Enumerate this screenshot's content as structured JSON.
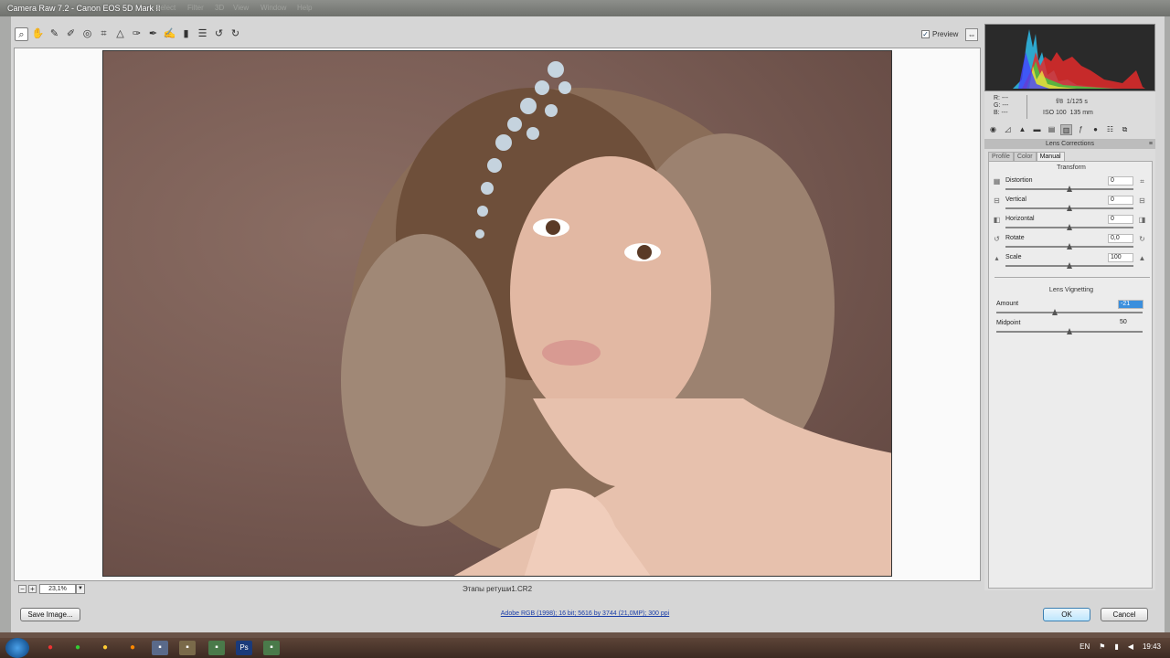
{
  "window": {
    "title": "Camera Raw 7.2  -  Canon EOS 5D Mark II",
    "ghost_menu": [
      "Select",
      "Filter",
      "3D",
      "View",
      "Window",
      "Help"
    ]
  },
  "toolbar": {
    "tools": [
      {
        "name": "zoom-tool",
        "icon": "zoom-icon",
        "glyph": "⌕",
        "active": true
      },
      {
        "name": "hand-tool",
        "icon": "hand-icon",
        "glyph": "✋"
      },
      {
        "name": "white-balance-tool",
        "icon": "eyedropper-icon",
        "glyph": "✎"
      },
      {
        "name": "color-sampler-tool",
        "icon": "color-sampler-icon",
        "glyph": "✐"
      },
      {
        "name": "targeted-adjustment-tool",
        "icon": "target-icon",
        "glyph": "◎"
      },
      {
        "name": "crop-tool",
        "icon": "crop-icon",
        "glyph": "⌗"
      },
      {
        "name": "straighten-tool",
        "icon": "straighten-icon",
        "glyph": "△"
      },
      {
        "name": "spot-removal-tool",
        "icon": "spot-removal-icon",
        "glyph": "✑"
      },
      {
        "name": "red-eye-tool",
        "icon": "red-eye-icon",
        "glyph": "✒"
      },
      {
        "name": "adjustment-brush-tool",
        "icon": "brush-icon",
        "glyph": "✍"
      },
      {
        "name": "graduated-filter-tool",
        "icon": "gradient-icon",
        "glyph": "▮"
      },
      {
        "name": "preferences-button",
        "icon": "list-icon",
        "glyph": "☰"
      },
      {
        "name": "rotate-ccw-button",
        "icon": "rotate-left-icon",
        "glyph": "↺"
      },
      {
        "name": "rotate-cw-button",
        "icon": "rotate-right-icon",
        "glyph": "↻"
      }
    ],
    "preview_label": "Preview",
    "preview_checked": true
  },
  "status": {
    "zoom": "23,1%",
    "filename": "Этапы ретуши1.CR2"
  },
  "bottom": {
    "save_label": "Save Image...",
    "workflow_link": "Adobe RGB (1998); 16 bit; 5616 by 3744 (21,0MP); 300 ppi",
    "ok_label": "OK",
    "cancel_label": "Cancel"
  },
  "readout": {
    "r": "R:   ---",
    "g": "G:   ---",
    "b": "B:   ---",
    "aperture": "f/8",
    "shutter": "1/125 s",
    "iso": "ISO 100",
    "focal": "135 mm"
  },
  "panel": {
    "section_title": "Lens Corrections",
    "subtabs": [
      "Profile",
      "Color",
      "Manual"
    ],
    "active_subtab": "Manual",
    "transform_title": "Transform",
    "transform_sliders": [
      {
        "name": "distortion",
        "label": "Distortion",
        "value": "0",
        "position": 0.5
      },
      {
        "name": "vertical",
        "label": "Vertical",
        "value": "0",
        "position": 0.5
      },
      {
        "name": "horizontal",
        "label": "Horizontal",
        "value": "0",
        "position": 0.5
      },
      {
        "name": "rotate",
        "label": "Rotate",
        "value": "0,0",
        "position": 0.5
      },
      {
        "name": "scale",
        "label": "Scale",
        "value": "100",
        "position": 0.5
      }
    ],
    "vignetting_title": "Lens Vignetting",
    "vignetting_sliders": [
      {
        "name": "amount",
        "label": "Amount",
        "value": "-21",
        "position": 0.4,
        "selected": true
      },
      {
        "name": "midpoint",
        "label": "Midpoint",
        "value": "50",
        "position": 0.5
      }
    ]
  },
  "taskbar": {
    "language": "EN",
    "time": "19:43"
  }
}
